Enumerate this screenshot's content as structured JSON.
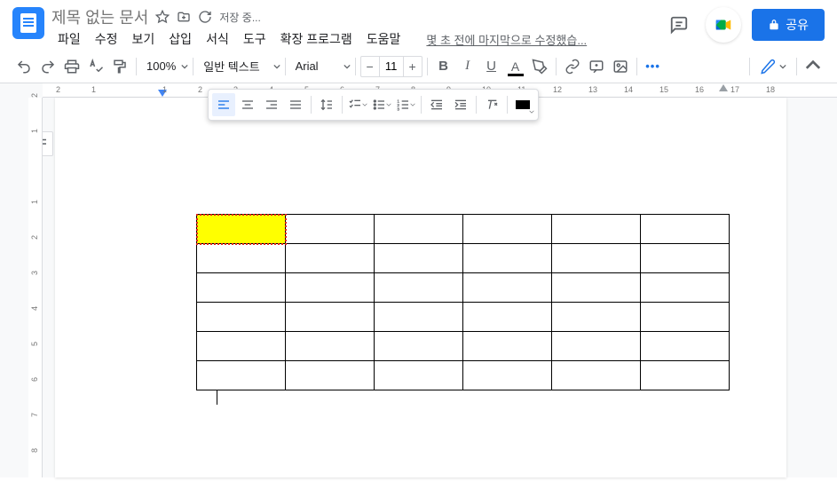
{
  "doc": {
    "title": "제목 없는 문서",
    "saving": "저장 중...",
    "last_edit": "몇 초 전에 마지막으로 수정했습..."
  },
  "menu": [
    "파일",
    "수정",
    "보기",
    "삽입",
    "서식",
    "도구",
    "확장 프로그램",
    "도움말"
  ],
  "toolbar": {
    "zoom": "100%",
    "style": "일반 텍스트",
    "font": "Arial",
    "font_size": "11"
  },
  "share": {
    "label": "공유"
  },
  "ruler_h": [
    "2",
    "1",
    "1",
    "2",
    "3",
    "4",
    "5",
    "6",
    "7",
    "8",
    "9",
    "10",
    "11",
    "12",
    "13",
    "14",
    "15",
    "16",
    "17",
    "18"
  ],
  "ruler_v": [
    "2",
    "1",
    "1",
    "2",
    "3",
    "4",
    "5",
    "6",
    "7",
    "8"
  ],
  "table": {
    "rows": 6,
    "cols": 6,
    "selected": [
      0,
      0
    ]
  }
}
